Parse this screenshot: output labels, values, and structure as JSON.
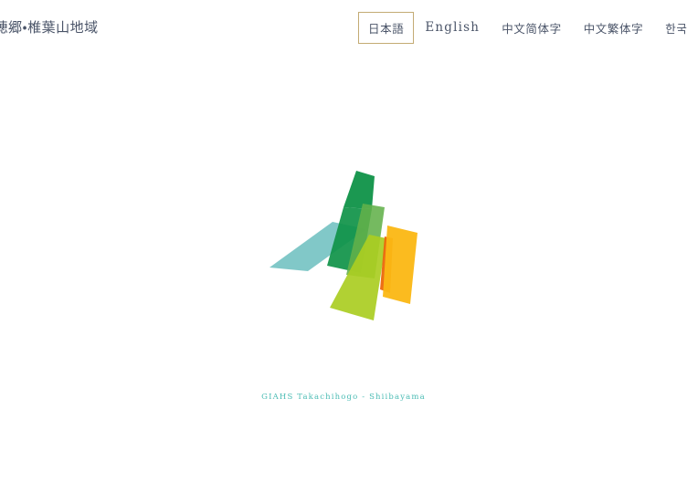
{
  "header": {
    "site_title": "千穂郷・椎葉山地域",
    "languages": [
      {
        "label": "日本語",
        "name": "lang-japanese",
        "current": true,
        "script": "cjk"
      },
      {
        "label": "English",
        "name": "lang-english",
        "current": false,
        "script": "latin"
      },
      {
        "label": "中文简体字",
        "name": "lang-chinese-simplified",
        "current": false,
        "script": "cjk"
      },
      {
        "label": "中文繁体字",
        "name": "lang-chinese-traditional",
        "current": false,
        "script": "cjk"
      },
      {
        "label": "한국어(",
        "name": "lang-korean",
        "current": false,
        "script": "cjk"
      }
    ]
  },
  "main": {
    "logo": {
      "alt": "GIAHS Takachihogo-Shiibayama leaf mark",
      "colors": {
        "teal": "#7ac5c5",
        "dark_green": "#0f9248",
        "mid_green": "#62b14a",
        "yellow_green": "#aacd22",
        "amber": "#fbb713",
        "orange": "#ec6608"
      }
    },
    "caption": "GIAHS  Takachihogo - Shiibayama"
  },
  "theme": {
    "background": "#ffffff",
    "text": "#4a5468",
    "accent_border": "#c3ab74",
    "caption_color": "#4bbcb4"
  }
}
